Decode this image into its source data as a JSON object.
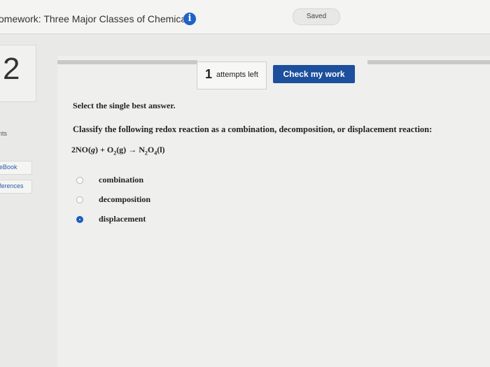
{
  "header": {
    "title": "omework: Three Major Classes of Chemical",
    "info_icon": "info-icon",
    "saved_label": "Saved"
  },
  "question_number": "2",
  "sidebar": {
    "points_label": "nts",
    "ebook_label": "eBook",
    "references_label": "ferences"
  },
  "toolbar": {
    "attempts_count": "1",
    "attempts_label": "attempts left",
    "check_label": "Check my work"
  },
  "question": {
    "instruction": "Select the single best answer.",
    "prompt": "Classify the following redox reaction as a combination, decomposition, or displacement reaction:",
    "equation": {
      "r1": "2NO(",
      "r1_state": "g",
      "r1_end": ")",
      "plus": " + ",
      "r2": "O",
      "r2_sub": "2",
      "r2_state": "(g)",
      "arrow": " → ",
      "p1": "N",
      "p1_sub1": "2",
      "p1_mid": "O",
      "p1_sub2": "4",
      "p1_state": "(l)"
    },
    "choices": [
      {
        "label": "combination",
        "selected": false
      },
      {
        "label": "decomposition",
        "selected": false
      },
      {
        "label": "displacement",
        "selected": true
      }
    ]
  },
  "colors": {
    "accent": "#1c4f9c",
    "info": "#1f63c7",
    "radio_selected": "#1d5cc2"
  }
}
